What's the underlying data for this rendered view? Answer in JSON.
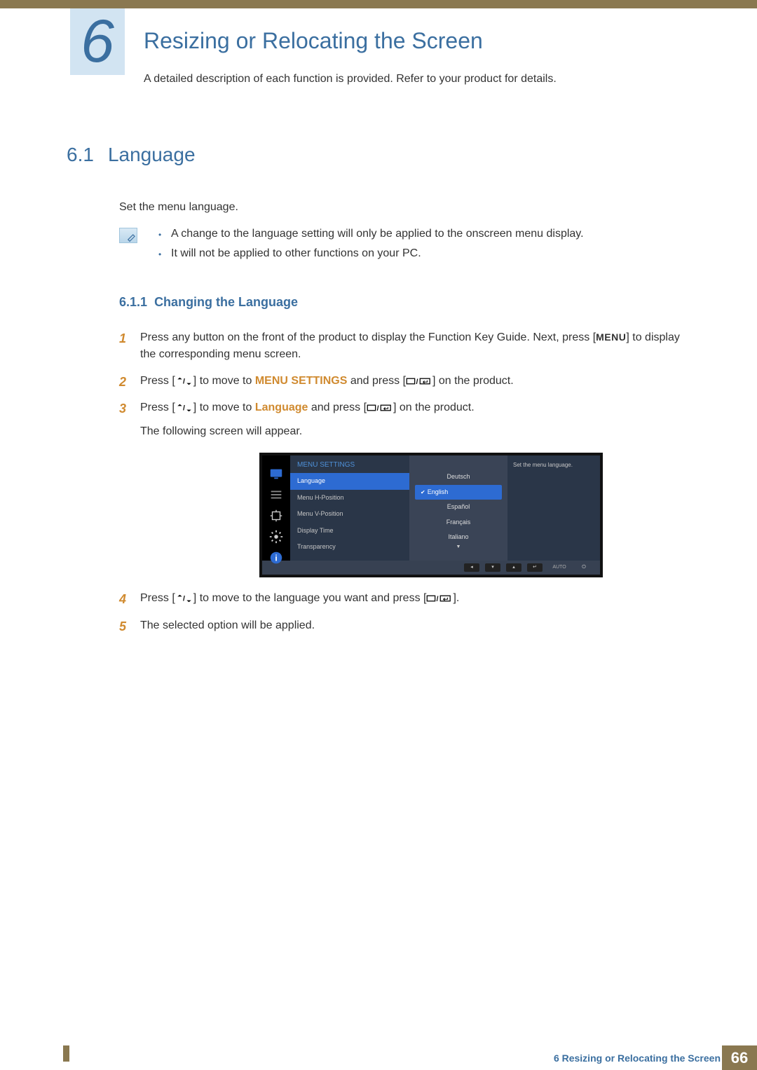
{
  "chapter": {
    "number": "6",
    "title": "Resizing or Relocating the Screen",
    "description": "A detailed description of each function is provided. Refer to your product for details."
  },
  "section61": {
    "number": "6.1",
    "title": "Language",
    "intro": "Set the menu language.",
    "notes": [
      "A change to the language setting will only be applied to the onscreen menu display.",
      "It will not be applied to other functions on your PC."
    ]
  },
  "section611": {
    "number": "6.1.1",
    "title": "Changing the Language",
    "steps": {
      "s1a": "Press any button on the front of the product to display the Function Key Guide. Next, press [",
      "s1b": "] to display the corresponding menu screen.",
      "s1_menu": "MENU",
      "s2a": "Press [",
      "s2b": "] to move to ",
      "s2_kw": "MENU SETTINGS",
      "s2c": " and press [",
      "s2d": "] on the product.",
      "s3a": "Press [",
      "s3b": "] to move to ",
      "s3_kw": "Language",
      "s3c": " and press [",
      "s3d": "] on the product.",
      "s3e": "The following screen will appear.",
      "s4a": "Press [",
      "s4b": "] to move to the language you want and press [",
      "s4c": "].",
      "s5": "The selected option will be applied."
    }
  },
  "osd": {
    "title": "MENU SETTINGS",
    "left_items": [
      "Language",
      "Menu H-Position",
      "Menu V-Position",
      "Display Time",
      "Transparency"
    ],
    "mid_items": [
      "Deutsch",
      "English",
      "Español",
      "Français",
      "Italiano"
    ],
    "hint": "Set the menu language.",
    "bottom": {
      "auto": "AUTO"
    }
  },
  "footer": {
    "text": "6 Resizing or Relocating the Screen",
    "page": "66"
  }
}
